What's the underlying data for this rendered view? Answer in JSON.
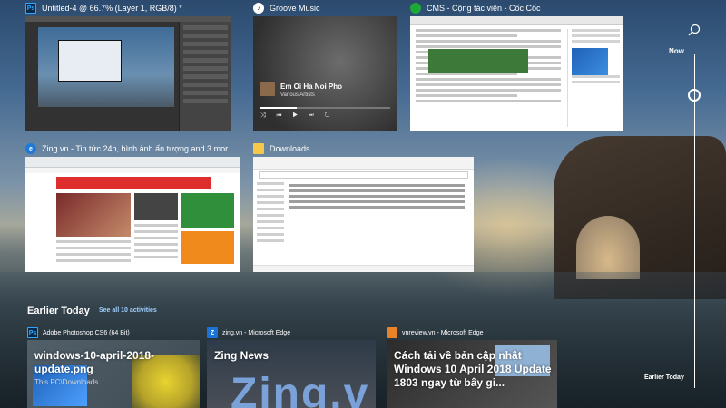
{
  "windows": [
    {
      "id": "photoshop",
      "title": "Untitled-4 @ 66.7% (Layer 1, RGB/8) *",
      "icon": "photoshop-icon",
      "icon_glyph": "Ps"
    },
    {
      "id": "groove",
      "title": "Groove Music",
      "icon": "groove-music-icon",
      "song": "Em Oi Ha Noi Pho",
      "artist": "Various Artists",
      "controls": "⤨ ⏮ ▶ ⏭ ↻"
    },
    {
      "id": "cms",
      "title": "CMS - Cộng tác viên - Cốc Cốc",
      "icon": "coccoc-icon"
    },
    {
      "id": "zing",
      "title": "Zing.vn - Tin tức 24h, hình ảnh ấn tượng and 3 more pages -...",
      "icon": "edge-icon",
      "icon_glyph": "e"
    },
    {
      "id": "downloads",
      "title": "Downloads",
      "icon": "folder-icon"
    }
  ],
  "earlier_today": {
    "title": "Earlier Today",
    "see_all": "See all 10 activities",
    "cards": [
      {
        "app": "Adobe Photoshop CS6 (64 Bit)",
        "icon_glyph": "Ps",
        "heading": "windows-10-april-2018-update.png",
        "sub": "This PC\\Downloads"
      },
      {
        "app": "zing.vn - Microsoft Edge",
        "icon_glyph": "Z",
        "heading": "Zing News",
        "logo": "Zing.v"
      },
      {
        "app": "vnreview.vn - Microsoft Edge",
        "heading": "Cách tải về bản cập nhật Windows 10 April 2018 Update 1803 ngay từ bây gi..."
      }
    ]
  },
  "timeline": {
    "now_label": "Now",
    "earlier_label": "Earlier Today"
  }
}
